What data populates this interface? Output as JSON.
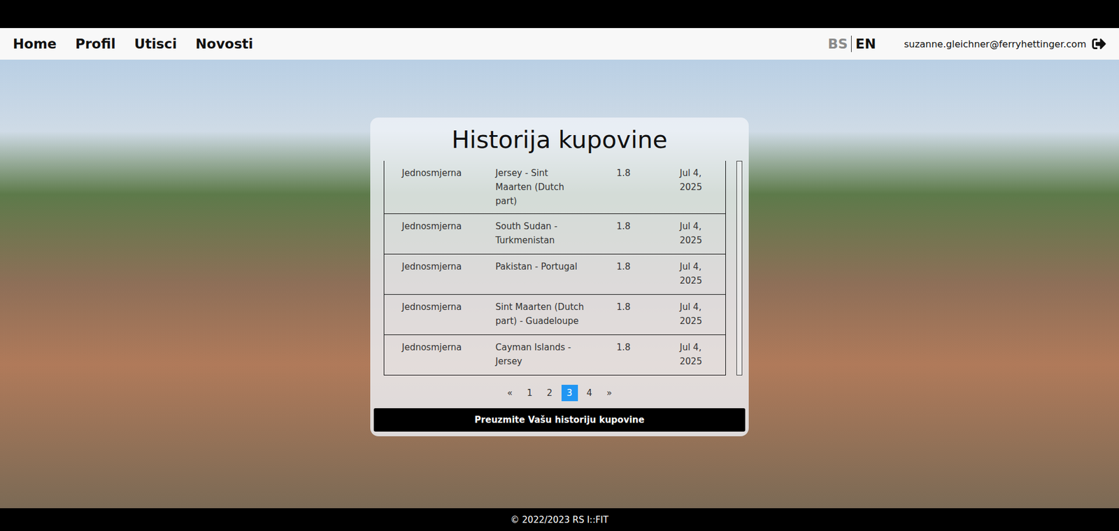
{
  "nav": {
    "items": [
      "Home",
      "Profil",
      "Utisci",
      "Novosti"
    ],
    "languages": [
      {
        "label": "BS",
        "selected": false
      },
      {
        "label": "EN",
        "selected": true
      }
    ],
    "user": "suzanne.gleichner@ferryhettinger.com"
  },
  "card": {
    "title": "Historija kupovine",
    "table": {
      "rows": [
        [
          "Jednosmjerna",
          "Jersey - Sint Maarten (Dutch part)",
          "1.8",
          "Jul 4, 2025"
        ],
        [
          "Jednosmjerna",
          "South Sudan - Turkmenistan",
          "1.8",
          "Jul 4, 2025"
        ],
        [
          "Jednosmjerna",
          "Pakistan - Portugal",
          "1.8",
          "Jul 4, 2025"
        ],
        [
          "Jednosmjerna",
          "Sint Maarten (Dutch part) - Guadeloupe",
          "1.8",
          "Jul 4, 2025"
        ],
        [
          "Jednosmjerna",
          "Cayman Islands - Jersey",
          "1.8",
          "Jul 4, 2025"
        ]
      ]
    },
    "pagination": {
      "prev": "«",
      "next": "»",
      "pages": [
        {
          "label": "1",
          "selected": false
        },
        {
          "label": "2",
          "selected": false
        },
        {
          "label": "3",
          "selected": true
        },
        {
          "label": "4",
          "selected": false
        }
      ]
    },
    "button": "Preuzmite Vašu historiju kupovine"
  },
  "footer": "© 2022/2023 RS I::FIT"
}
